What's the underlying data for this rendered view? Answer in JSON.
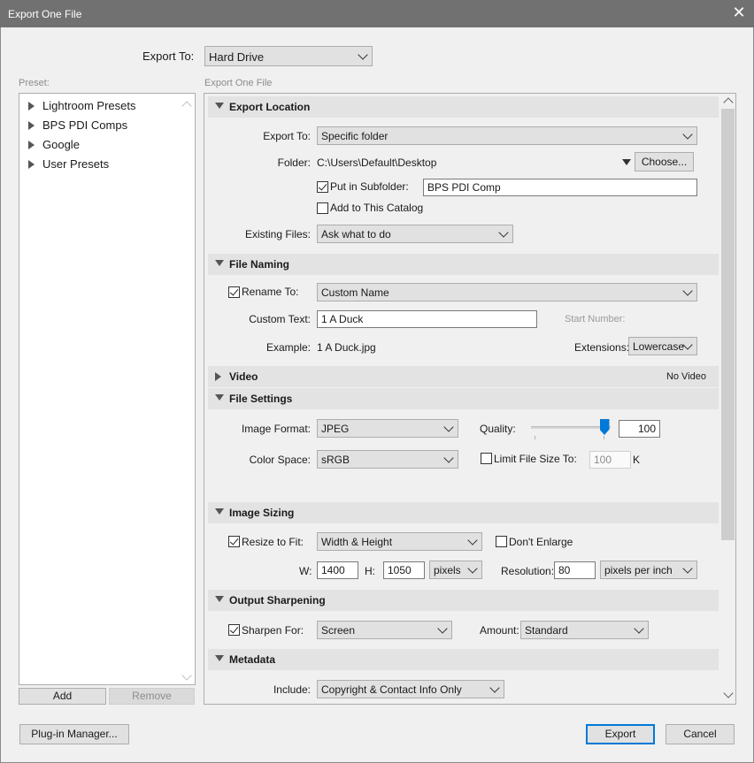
{
  "window": {
    "title": "Export One File",
    "close_glyph": "✕"
  },
  "export_to": {
    "label": "Export To:",
    "value": "Hard Drive"
  },
  "preset": {
    "label": "Preset:",
    "items": [
      "Lightroom Presets",
      "BPS PDI Comps",
      "Google",
      "User Presets"
    ],
    "add_label": "Add",
    "remove_label": "Remove"
  },
  "panel_title": "Export One File",
  "export_location": {
    "title": "Export Location",
    "export_to_label": "Export To:",
    "export_to_value": "Specific folder",
    "folder_label": "Folder:",
    "folder_path": "C:\\Users\\Default\\Desktop",
    "choose_label": "Choose...",
    "subfolder_label": "Put in Subfolder:",
    "subfolder_checked": true,
    "subfolder_value": "BPS PDI Comp",
    "add_catalog_label": "Add to This Catalog",
    "add_catalog_checked": false,
    "existing_files_label": "Existing Files:",
    "existing_files_value": "Ask what to do"
  },
  "file_naming": {
    "title": "File Naming",
    "rename_label": "Rename To:",
    "rename_checked": true,
    "rename_value": "Custom Name",
    "custom_text_label": "Custom Text:",
    "custom_text_value": "1 A Duck",
    "start_number_label": "Start Number:",
    "example_label": "Example:",
    "example_value": "1 A Duck.jpg",
    "extensions_label": "Extensions:",
    "extensions_value": "Lowercase"
  },
  "video": {
    "title": "Video",
    "status": "No Video"
  },
  "file_settings": {
    "title": "File Settings",
    "image_format_label": "Image Format:",
    "image_format_value": "JPEG",
    "quality_label": "Quality:",
    "quality_value": "100",
    "quality_level": 1.0,
    "color_space_label": "Color Space:",
    "color_space_value": "sRGB",
    "limit_size_label": "Limit File Size To:",
    "limit_size_checked": false,
    "limit_size_value": "100",
    "limit_size_unit": "K"
  },
  "image_sizing": {
    "title": "Image Sizing",
    "resize_label": "Resize to Fit:",
    "resize_checked": true,
    "resize_value": "Width & Height",
    "dont_enlarge_label": "Don't Enlarge",
    "dont_enlarge_checked": false,
    "w_label": "W:",
    "w_value": "1400",
    "h_label": "H:",
    "h_value": "1050",
    "unit_value": "pixels",
    "resolution_label": "Resolution:",
    "resolution_value": "80",
    "resolution_unit": "pixels per inch"
  },
  "output_sharpening": {
    "title": "Output Sharpening",
    "sharpen_label": "Sharpen For:",
    "sharpen_checked": true,
    "sharpen_value": "Screen",
    "amount_label": "Amount:",
    "amount_value": "Standard"
  },
  "metadata": {
    "title": "Metadata",
    "include_label": "Include:",
    "include_value": "Copyright & Contact Info Only"
  },
  "footer": {
    "plugin_manager_label": "Plug-in Manager...",
    "export_label": "Export",
    "cancel_label": "Cancel"
  }
}
